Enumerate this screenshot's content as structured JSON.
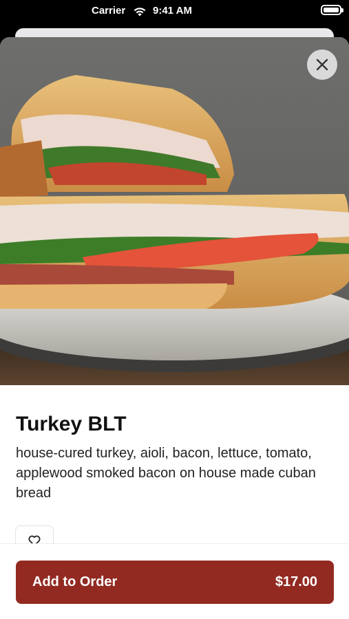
{
  "status_bar": {
    "carrier": "Carrier",
    "time": "9:41 AM"
  },
  "icons": {
    "wifi": "wifi-icon",
    "battery": "battery-icon",
    "close": "close-icon",
    "favorite": "heart-icon"
  },
  "item": {
    "name": "Turkey BLT",
    "description": "house-cured turkey, aioli, bacon, lettuce, tomato, applewood smoked bacon on house made cuban bread"
  },
  "order": {
    "add_label": "Add to Order",
    "price": "$17.00"
  },
  "colors": {
    "accent": "#922a22",
    "close_bg": "#d9d9d9"
  }
}
